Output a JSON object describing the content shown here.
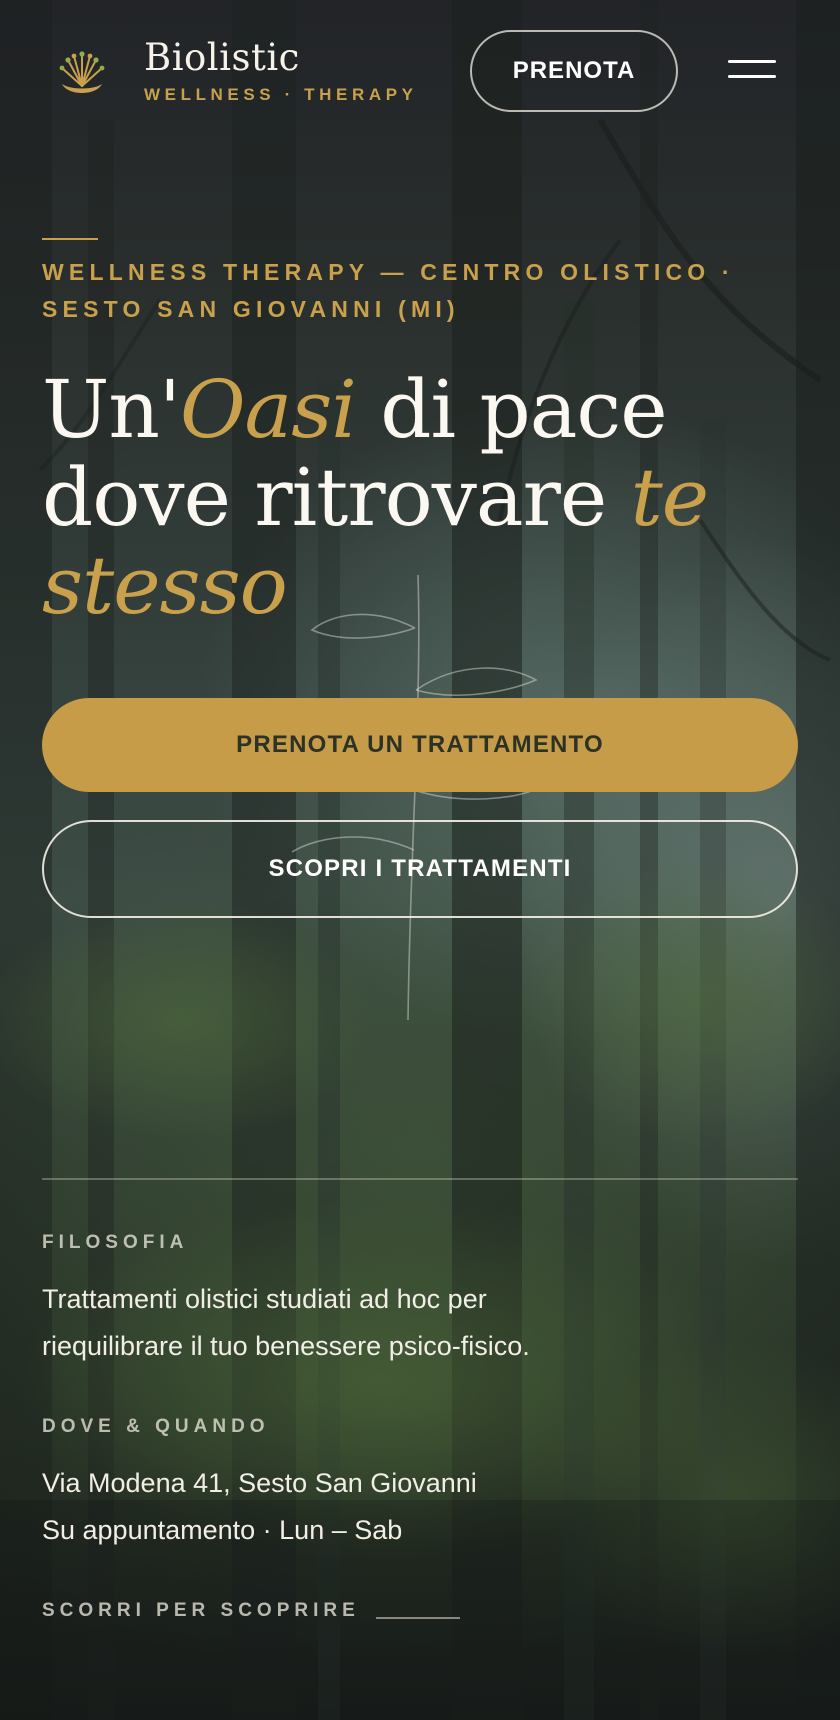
{
  "header": {
    "logo_icon": "lotus-fan-icon",
    "brand_name": "Biolistic",
    "brand_tagline": "WELLNESS · THERAPY",
    "book_button_label": "PRENOTA",
    "menu_icon": "hamburger-menu-icon"
  },
  "hero": {
    "eyebrow_line1": "WELLNESS THERAPY — CENTRO OLISTICO ·",
    "eyebrow_line2": "SESTO SAN GIOVANNI (MI)",
    "title_part1": "Un'",
    "title_highlight1": "Oasi",
    "title_part2": " di pace",
    "title_part3": "dove ritrovare ",
    "title_highlight2": "te",
    "title_highlight3": "stesso",
    "primary_button_label": "PRENOTA UN TRATTAMENTO",
    "secondary_button_label": "SCOPRI I TRATTAMENTI"
  },
  "info": {
    "philosophy_label": "FILOSOFIA",
    "philosophy_line1": "Trattamenti olistici studiati ad hoc per",
    "philosophy_line2": "riequilibrare il tuo benessere psico-fisico.",
    "where_label": "DOVE & QUANDO",
    "address": "Via Modena 41, Sesto San Giovanni",
    "hours": "Su appuntamento · Lun – Sab"
  },
  "scroll_hint": "SCORRI PER SCOPRIRE",
  "colors": {
    "accent_gold": "#c9a04c",
    "button_gold": "#c69c48",
    "text_light": "#f4f1ea",
    "background_forest": "#2f3b31"
  }
}
